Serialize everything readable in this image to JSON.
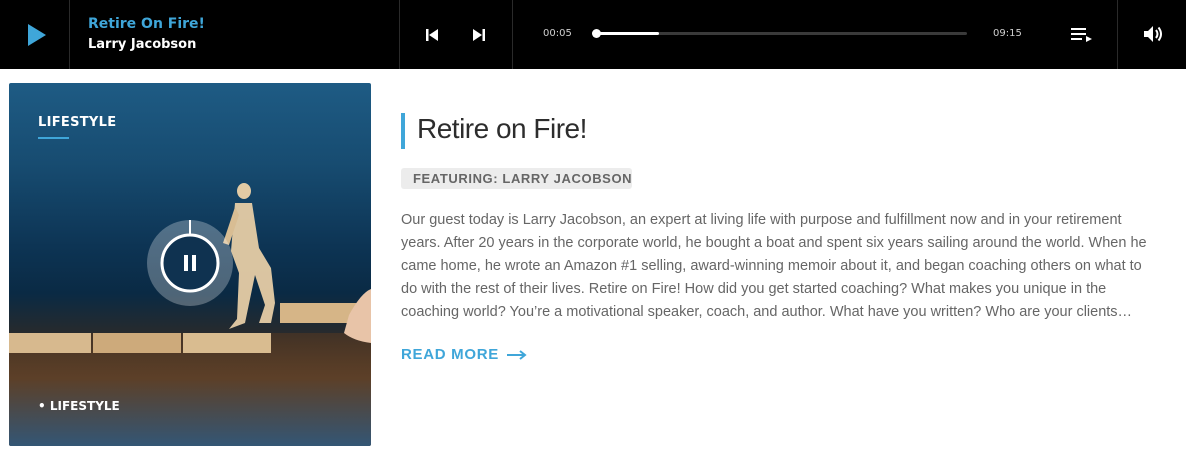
{
  "player": {
    "track_title": "Retire On Fire!",
    "artist": "Larry Jacobson",
    "current_time": "00:05",
    "total_time": "09:15",
    "progress": 0.17,
    "accent": "#3fa6d9",
    "icons": [
      "play-icon",
      "previous-icon",
      "next-icon",
      "playlist-icon",
      "volume-icon"
    ]
  },
  "card": {
    "category_top": "LIFESTYLE",
    "category_bottom": "LIFESTYLE",
    "icons": [
      "pause-icon"
    ]
  },
  "article": {
    "title": "Retire on Fire!",
    "featuring": "FEATURING: LARRY JACOBSON",
    "excerpt": "Our guest today is Larry Jacobson, an expert at living life with purpose and fulfillment now and in your retirement years. After 20 years in the corporate world, he bought a boat and spent six years sailing around the world. When he came home, he wrote an Amazon #1 selling, award-winning memoir about it, and began coaching others on what to do with the rest of their lives. Retire on Fire! How did you get started coaching? What makes you unique in the coaching world? You’re a motivational speaker, coach, and author. What have you written? Who are your clients…",
    "read_more": "READ MORE"
  }
}
